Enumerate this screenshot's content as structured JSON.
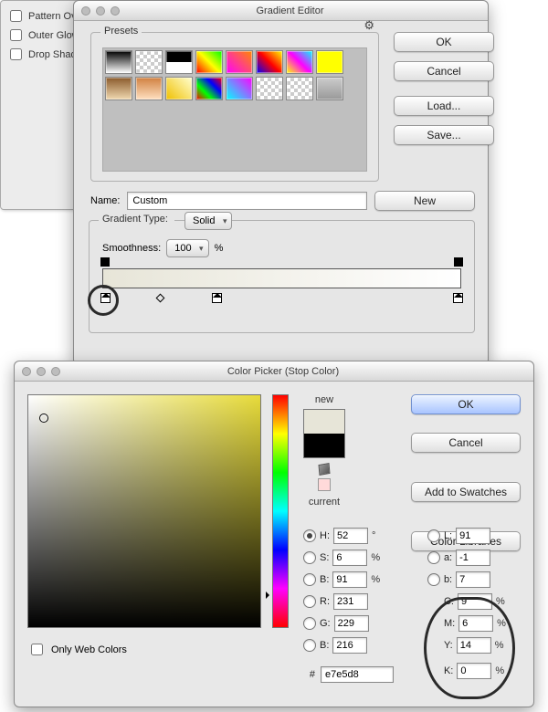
{
  "fx": {
    "items": [
      {
        "label": "Pattern Overlay",
        "checked": false
      },
      {
        "label": "Outer Glow",
        "checked": false
      },
      {
        "label": "Drop Shadow",
        "checked": false
      }
    ]
  },
  "gradient_editor": {
    "title": "Gradient Editor",
    "presets_label": "Presets",
    "buttons": {
      "ok": "OK",
      "cancel": "Cancel",
      "load": "Load...",
      "save": "Save...",
      "new": "New"
    },
    "name_label": "Name:",
    "name_value": "Custom",
    "type_label": "Gradient Type:",
    "type_value": "Solid",
    "smooth_label": "Smoothness:",
    "smooth_value": "100",
    "smooth_unit": "%",
    "preset_colors": [
      "linear-gradient(#000,#fff)",
      "repeating-conic-gradient(#ccc 0 25%,#fff 0 50%) 0/8px 8px,linear-gradient(#000,transparent)",
      "linear-gradient(#000 50%,#fff 50%)",
      "linear-gradient(45deg,#f00,#ff0,#0f0)",
      "linear-gradient(45deg,#f0f,#f80)",
      "linear-gradient(45deg,#00f,#f00,#ff0)",
      "linear-gradient(45deg,#ff0,#f0f,#0ff)",
      "linear-gradient(#ff0,#ff0)",
      "linear-gradient(#8a5a2b,#f0d8b0)",
      "linear-gradient(#d08040,#ffe0c0)",
      "linear-gradient(45deg,#f0c000,#ffffd0)",
      "linear-gradient(45deg,#f00,#0f0,#00f,#f00)",
      "linear-gradient(45deg,#0ff,#f0f)",
      "repeating-conic-gradient(#ccc 0 25%,#fff 0 50%) 0/8px 8px",
      "repeating-conic-gradient(#ccc 0 25%,#fff 0 50%) 0/8px 8px",
      "linear-gradient(#ccc,#999)"
    ],
    "gradient_stops": {
      "left": "#e7e5d8",
      "right": "#ffffff"
    }
  },
  "color_picker": {
    "title": "Color Picker (Stop Color)",
    "buttons": {
      "ok": "OK",
      "cancel": "Cancel",
      "add": "Add to Swatches",
      "libs": "Color Libraries"
    },
    "new_label": "new",
    "current_label": "current",
    "new_color": "#e7e5d8",
    "current_color": "#000000",
    "only_web_label": "Only Web Colors",
    "only_web_checked": false,
    "hsb": {
      "h": "52",
      "s": "6",
      "b": "91"
    },
    "rgb": {
      "r": "231",
      "g": "229",
      "b_": "216"
    },
    "lab": {
      "l": "91",
      "a": "-1",
      "b_": "7"
    },
    "cmyk": {
      "c": "9",
      "m": "6",
      "y": "14",
      "k": "0"
    },
    "hex_label": "#",
    "hex": "e7e5d8",
    "field_labels": {
      "h": "H:",
      "s": "S:",
      "b": "B:",
      "r": "R:",
      "g": "G:",
      "b2": "B:",
      "l": "L:",
      "a": "a:",
      "lb": "b:",
      "c": "C:",
      "m": "M:",
      "y": "Y:",
      "k": "K:"
    },
    "units": {
      "deg": "°",
      "pct": "%"
    }
  }
}
